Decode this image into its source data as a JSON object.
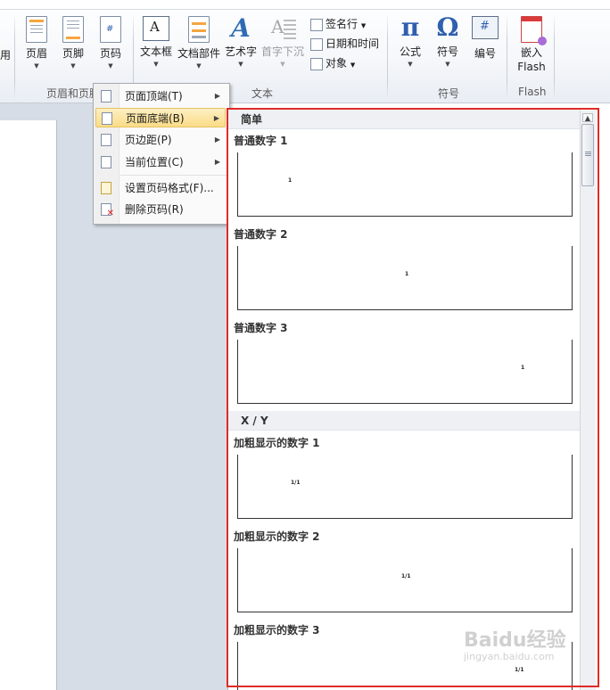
{
  "ribbon": {
    "partial_left_label": "用",
    "buttons": [
      {
        "id": "header",
        "label": "页眉"
      },
      {
        "id": "footer",
        "label": "页脚"
      },
      {
        "id": "pagenum",
        "label": "页码"
      },
      {
        "id": "textbox",
        "label": "文本框"
      },
      {
        "id": "quickparts",
        "label": "文档部件"
      },
      {
        "id": "wordart",
        "label": "艺术字"
      },
      {
        "id": "dropcap",
        "label": "首字下沉"
      },
      {
        "id": "equation",
        "label": "公式"
      },
      {
        "id": "symbol",
        "label": "符号"
      },
      {
        "id": "number",
        "label": "编号"
      },
      {
        "id": "flash",
        "label": "嵌入\nFlash"
      }
    ],
    "small_buttons": {
      "signature": "签名行",
      "datetime": "日期和时间",
      "object": "对象"
    },
    "groups": {
      "header_footer": "页眉和页脚",
      "text": "文本",
      "symbols": "符号",
      "flash": "Flash"
    }
  },
  "menu": {
    "items": [
      {
        "label": "页面顶端(T)",
        "has_submenu": true
      },
      {
        "label": "页面底端(B)",
        "has_submenu": true,
        "highlighted": true
      },
      {
        "label": "页边距(P)",
        "has_submenu": true
      },
      {
        "label": "当前位置(C)",
        "has_submenu": true
      },
      {
        "label": "设置页码格式(F)...",
        "has_submenu": false
      },
      {
        "label": "删除页码(R)",
        "has_submenu": false
      }
    ]
  },
  "gallery": {
    "sections": [
      {
        "header": "简单",
        "items": [
          {
            "title": "普通数字 1",
            "sample": "1",
            "align": "left"
          },
          {
            "title": "普通数字 2",
            "sample": "1",
            "align": "center"
          },
          {
            "title": "普通数字 3",
            "sample": "1",
            "align": "right"
          }
        ]
      },
      {
        "header": "X / Y",
        "items": [
          {
            "title": "加粗显示的数字 1",
            "sample": "1/1",
            "align": "left"
          },
          {
            "title": "加粗显示的数字 2",
            "sample": "1/1",
            "align": "center"
          },
          {
            "title": "加粗显示的数字 3",
            "sample": "1/1",
            "align": "right"
          }
        ]
      }
    ]
  },
  "watermark": {
    "brand": "Baidu经验",
    "url": "jingyan.baidu.com"
  },
  "colors": {
    "highlight_border": "#e02b27",
    "menu_highlight": "#fbdc86"
  }
}
